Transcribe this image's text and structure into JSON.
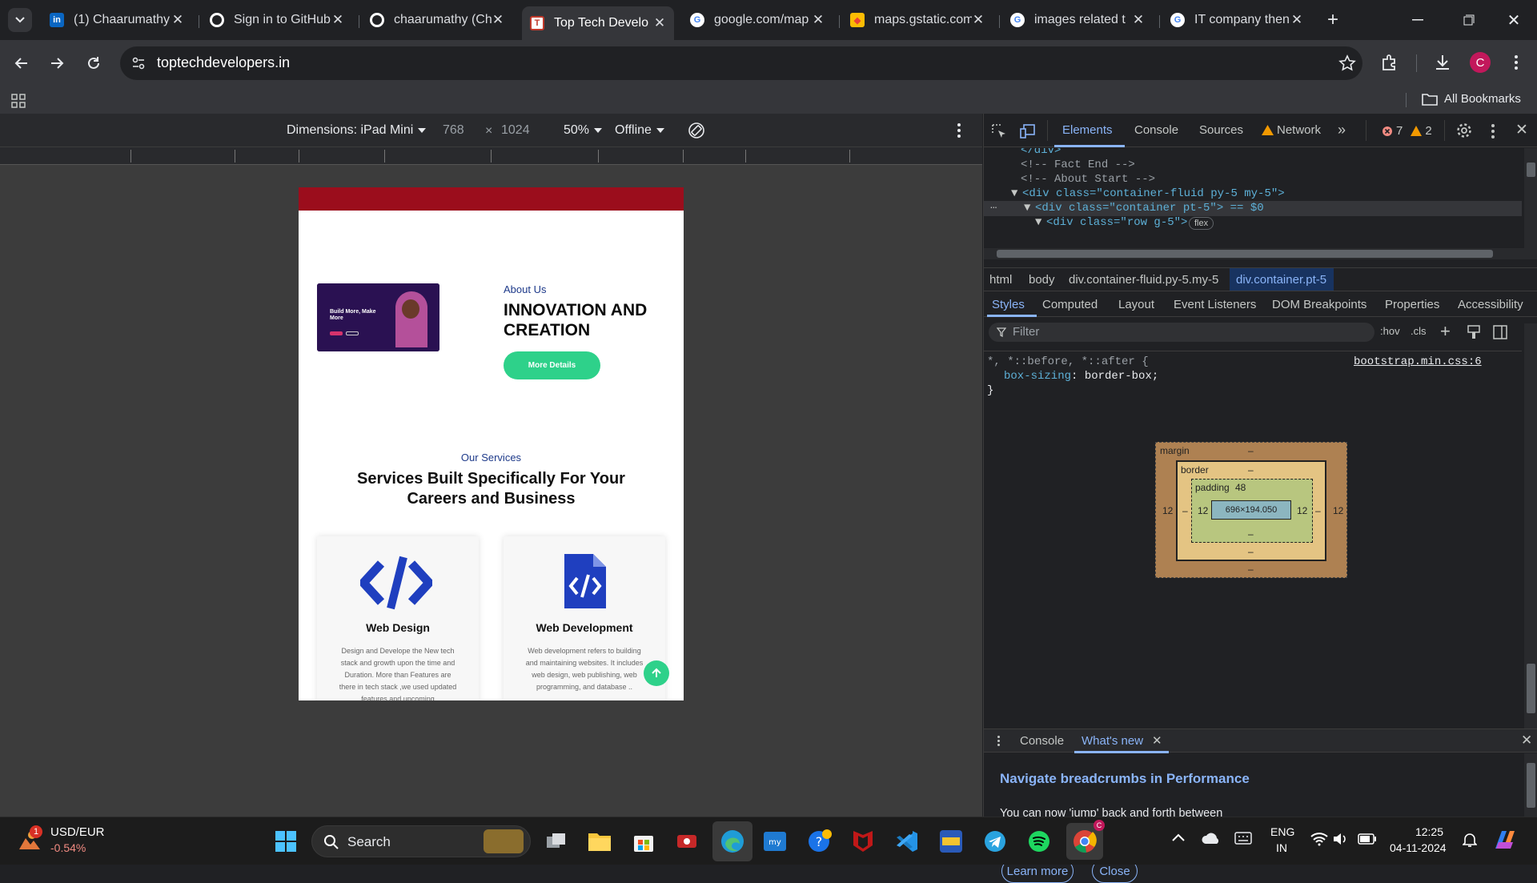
{
  "tabs": [
    {
      "label": "(1) Chaarumathy",
      "icon": "linkedin-icon"
    },
    {
      "label": "Sign in to GitHub",
      "icon": "github-icon"
    },
    {
      "label": "chaarumathy (Ch",
      "icon": "github-icon"
    },
    {
      "label": "Top Tech Develo",
      "icon": "site-icon",
      "active": true
    },
    {
      "label": "google.com/map",
      "icon": "google-icon"
    },
    {
      "label": "maps.gstatic.com",
      "icon": "maps-icon"
    },
    {
      "label": "images related t",
      "icon": "google-icon"
    },
    {
      "label": "IT company then",
      "icon": "google-icon"
    }
  ],
  "address": {
    "url": "toptechdevelopers.in"
  },
  "profile_initial": "C",
  "bookmarks": {
    "all_label": "All Bookmarks"
  },
  "device_bar": {
    "dimensions_label": "Dimensions: iPad Mini",
    "width": "768",
    "times": "×",
    "height": "1024",
    "zoom": "50%",
    "throttle": "Offline"
  },
  "page": {
    "about_eyebrow": "About Us",
    "about_heading_line1": "INNOVATION AND",
    "about_heading_line2": "CREATION",
    "about_button": "More Details",
    "thumb_text": "Build More, Make More",
    "services_eyebrow": "Our Services",
    "services_heading_line1": "Services Built Specifically For Your",
    "services_heading_line2": "Careers and Business",
    "cards": [
      {
        "title": "Web Design",
        "lines": [
          "Design and Develope the New tech",
          "stack and growth upon the time and",
          "Duration. More than Features are",
          "there in tech stack ,we used updated",
          "features and upcoming"
        ]
      },
      {
        "title": "Web Development",
        "lines": [
          "Web development refers to building",
          "and maintaining websites. It includes",
          "web design, web publishing, web",
          "programming, and database .."
        ]
      }
    ]
  },
  "devtools": {
    "tabs": [
      "Elements",
      "Console",
      "Sources",
      "Network"
    ],
    "error_count": "7",
    "warning_count": "2",
    "dom_lines": [
      "</div>",
      "<!-- Fact End -->",
      "<!-- About Start -->",
      "<div class=\"container-fluid py-5 my-5\">",
      "<div class=\"container pt-5\"> == $0",
      "<div class=\"row g-5\">"
    ],
    "flex_badge": "flex",
    "breadcrumbs": [
      "html",
      "body",
      "div.container-fluid.py-5.my-5",
      "div.container.pt-5"
    ],
    "style_tabs": [
      "Styles",
      "Computed",
      "Layout",
      "Event Listeners",
      "DOM Breakpoints",
      "Properties",
      "Accessibility"
    ],
    "filter_placeholder": "Filter",
    "hov": ":hov",
    "cls": ".cls",
    "rule_selector": "*, *::before, *::after {",
    "rule_property": "box-sizing",
    "rule_value": "border-box;",
    "rule_close": "}",
    "rule_source": "bootstrap.min.css:6",
    "box_model": {
      "margin_label": "margin",
      "border_label": "border",
      "padding_label": "padding",
      "dash": "–",
      "padding_top": "48",
      "side": "12",
      "content": "696×194.050"
    },
    "drawer_tabs": [
      "Console",
      "What's new"
    ],
    "whats_new_title": "Navigate breadcrumbs in Performance",
    "whats_new_body": "You can now 'jump' back and forth between breadcrumbs in the timeline, as well as overwrite and remove child breadcrumbs.",
    "learn_more": "Learn more",
    "close": "Close"
  },
  "taskbar": {
    "weather_badge": "1",
    "ticker_name": "USD/EUR",
    "ticker_change": "-0.54%",
    "search_placeholder": "Search",
    "lang_line1": "ENG",
    "lang_line2": "IN",
    "time": "12:25",
    "date": "04-11-2024"
  }
}
